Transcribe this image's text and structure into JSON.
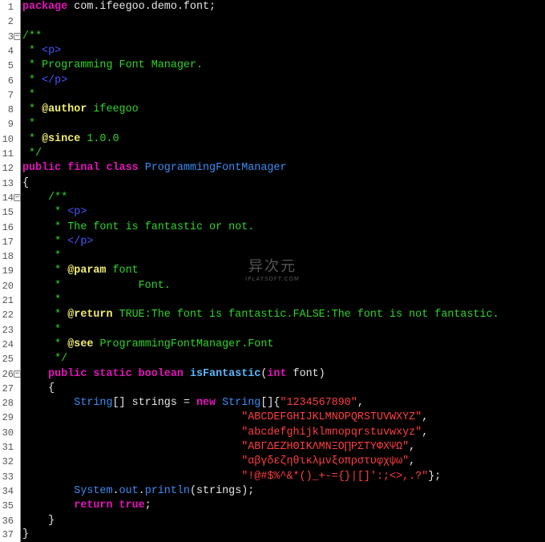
{
  "editor": {
    "line_numbers": [
      "1",
      "2",
      "3",
      "4",
      "5",
      "6",
      "7",
      "8",
      "9",
      "10",
      "11",
      "12",
      "13",
      "14",
      "15",
      "16",
      "17",
      "18",
      "19",
      "20",
      "21",
      "22",
      "23",
      "24",
      "25",
      "26",
      "27",
      "28",
      "29",
      "30",
      "31",
      "32",
      "33",
      "34",
      "35",
      "36",
      "37"
    ],
    "fold_markers": {
      "collapse": "−"
    },
    "lines": {
      "l1": {
        "k1": "package",
        "t1": " com.ifeegoo.demo.font;"
      },
      "l3": {
        "c1": "/**"
      },
      "l4": {
        "c1": " * ",
        "g1": "<p>"
      },
      "l5": {
        "c1": " * Programming Font Manager."
      },
      "l6": {
        "c1": " * ",
        "g1": "</p>"
      },
      "l7": {
        "c1": " *"
      },
      "l8": {
        "c1": " * ",
        "d1": "@author",
        "c2": " ifeegoo"
      },
      "l9": {
        "c1": " *"
      },
      "l10": {
        "c1": " * ",
        "d1": "@since",
        "c2": " 1.0.0"
      },
      "l11": {
        "c1": " */"
      },
      "l12": {
        "k1": "public final class",
        "y1": " ProgrammingFontManager"
      },
      "l13": {
        "t1": "{"
      },
      "l14": {
        "c1": "    /**"
      },
      "l15": {
        "c1": "     * ",
        "g1": "<p>"
      },
      "l16": {
        "c1": "     * The font is fantastic or not."
      },
      "l17": {
        "c1": "     * ",
        "g1": "</p>"
      },
      "l18": {
        "c1": "     *"
      },
      "l19": {
        "c1": "     * ",
        "d1": "@param",
        "c2": " font"
      },
      "l20": {
        "c1": "     *            Font."
      },
      "l21": {
        "c1": "     *"
      },
      "l22": {
        "c1": "     * ",
        "d1": "@return",
        "c2": " TRUE:The font is fantastic.FALSE:The font is not fantastic."
      },
      "l23": {
        "c1": "     *"
      },
      "l24": {
        "c1": "     * ",
        "d1": "@see",
        "c2": " ProgrammingFontManager.Font"
      },
      "l25": {
        "c1": "     */"
      },
      "l26": {
        "k1": "    public static boolean",
        "m1": " isFantastic",
        "t1": "(",
        "k2": "int",
        "t2": " font)"
      },
      "l27": {
        "t1": "    {"
      },
      "l28": {
        "y1": "        String",
        "t1": "[] strings = ",
        "k1": "new",
        "y2": " String",
        "t2": "[]{",
        "s1": "\"1234567890\"",
        "t3": ","
      },
      "l29": {
        "s1": "                                  \"ABCDEFGHIJKLMNOPQRSTUVWXYZ\"",
        "t1": ","
      },
      "l30": {
        "s1": "                                  \"abcdefghijklmnopqrstuvwxyz\"",
        "t1": ","
      },
      "l31": {
        "s1": "                                  \"ΑΒΓΔΕΖΗΘΙΚΛΜΝΞΟ∏ΡΣΤΥΦΧΨΩ\"",
        "t1": ","
      },
      "l32": {
        "s1": "                                  \"αβγδεζηθικλμνξοπρστυφχψω\"",
        "t1": ","
      },
      "l33": {
        "s1": "                                  \"!@#$%^&*()_+-={}|[]':;<>,.?\"",
        "t1": "};"
      },
      "l34": {
        "y1": "        System",
        "t1": ".",
        "y2": "out",
        "t2": ".",
        "y3": "println",
        "t3": "(strings);"
      },
      "l35": {
        "k1": "        return true",
        "t1": ";"
      },
      "l36": {
        "t1": "    }"
      },
      "l37": {
        "t1": "}"
      }
    }
  },
  "watermark": {
    "title": "异次元",
    "subtitle": "IPLAYSOFT.COM"
  },
  "colors": {
    "background": "#000000",
    "gutter": "#ffffff",
    "keyword": "#e313bb",
    "comment": "#2fd427",
    "html_tag": "#4b55ff",
    "javadoc_tag": "#f3ee6f",
    "type": "#3a8df5",
    "method": "#5cb8ff",
    "string": "#ff3e3e",
    "plain": "#e6e6e6"
  }
}
